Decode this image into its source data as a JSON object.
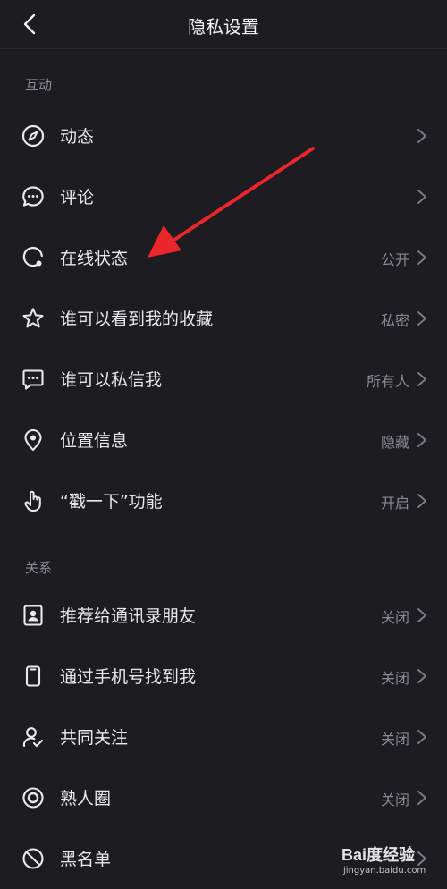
{
  "header": {
    "title": "隐私设置"
  },
  "sections": [
    {
      "label": "互动",
      "items": [
        {
          "label": "动态",
          "value": "",
          "icon": "compass-icon"
        },
        {
          "label": "评论",
          "value": "",
          "icon": "comment-bubble-icon"
        },
        {
          "label": "在线状态",
          "value": "公开",
          "icon": "online-status-icon"
        },
        {
          "label": "谁可以看到我的收藏",
          "value": "私密",
          "icon": "star-icon"
        },
        {
          "label": "谁可以私信我",
          "value": "所有人",
          "icon": "message-icon"
        },
        {
          "label": "位置信息",
          "value": "隐藏",
          "icon": "location-pin-icon"
        },
        {
          "label": "“戳一下”功能",
          "value": "开启",
          "icon": "poke-hand-icon"
        }
      ]
    },
    {
      "label": "关系",
      "items": [
        {
          "label": "推荐给通讯录朋友",
          "value": "关闭",
          "icon": "contact-card-icon"
        },
        {
          "label": "通过手机号找到我",
          "value": "关闭",
          "icon": "phone-icon"
        },
        {
          "label": "共同关注",
          "value": "关闭",
          "icon": "mutual-follow-icon"
        },
        {
          "label": "熟人圈",
          "value": "关闭",
          "icon": "circle-icon"
        },
        {
          "label": "黑名单",
          "value": "",
          "icon": "block-icon"
        }
      ]
    }
  ],
  "watermark": {
    "logo": "Bai度经验",
    "site": "jingyan.baidu.com"
  },
  "colors": {
    "background": "#1c1c21",
    "text": "#e9e9ee",
    "muted": "#8a8a92",
    "annotation_arrow": "#e8262b"
  }
}
